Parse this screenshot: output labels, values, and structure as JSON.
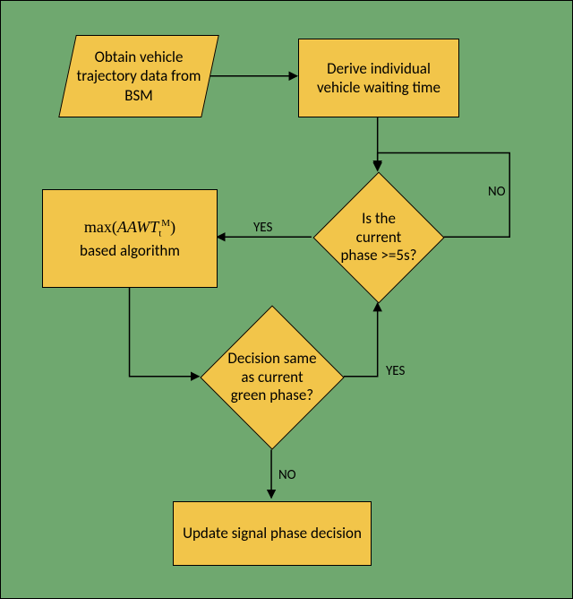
{
  "flow": {
    "nodes": {
      "input": {
        "text": "Obtain vehicle trajectory data from BSM"
      },
      "derive": {
        "text": "Derive individual vehicle waiting time"
      },
      "phase5s": {
        "text": "Is the current phase >=5s?"
      },
      "algo": {
        "prefix": "max(",
        "base": "AAWT",
        "sub": "t",
        "sup": "M",
        "suffix": ")",
        "line2": "based algorithm"
      },
      "decisionSame": {
        "text": "Decision same as current green phase?"
      },
      "update": {
        "text": "Update signal phase decision"
      }
    },
    "labels": {
      "yes": "YES",
      "no": "NO"
    }
  }
}
